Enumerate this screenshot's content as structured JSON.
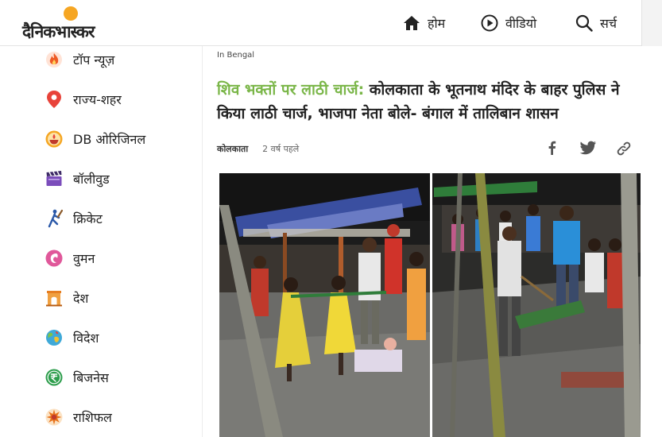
{
  "brand": {
    "name": "दैनिकभास्कर"
  },
  "nav": [
    {
      "label": "होम",
      "icon": "home-icon"
    },
    {
      "label": "वीडियो",
      "icon": "play-icon"
    },
    {
      "label": "सर्च",
      "icon": "search-icon"
    }
  ],
  "sidebar": {
    "items": [
      {
        "label": "टॉप न्यूज़",
        "icon": "flame-icon"
      },
      {
        "label": "राज्य-शहर",
        "icon": "location-pin-icon"
      },
      {
        "label": "DB ओरिजिनल",
        "icon": "diya-icon"
      },
      {
        "label": "बॉलीवुड",
        "icon": "clapperboard-icon"
      },
      {
        "label": "क्रिकेट",
        "icon": "cricket-player-icon"
      },
      {
        "label": "वुमन",
        "icon": "woman-icon"
      },
      {
        "label": "देश",
        "icon": "india-gate-icon"
      },
      {
        "label": "विदेश",
        "icon": "globe-icon"
      },
      {
        "label": "बिजनेस",
        "icon": "rupee-icon"
      },
      {
        "label": "राशिफल",
        "icon": "sun-icon"
      }
    ]
  },
  "article": {
    "section": "In Bengal",
    "headline_highlight": "शिव भक्तों पर लाठी चार्ज:",
    "headline_rest": " कोलकाता के भूतनाथ मंदिर के बाहर पुलिस ने किया लाठी चार्ज, भाजपा नेता बोले- बंगाल में तालिबान शासन",
    "city": "कोलकाता",
    "time": "2 वर्ष पहले"
  },
  "share": [
    {
      "icon": "facebook-icon"
    },
    {
      "icon": "twitter-icon"
    },
    {
      "icon": "link-icon"
    }
  ],
  "colors": {
    "accent_green": "#7ab648",
    "logo_orange": "#f6a623",
    "text": "#222222"
  }
}
